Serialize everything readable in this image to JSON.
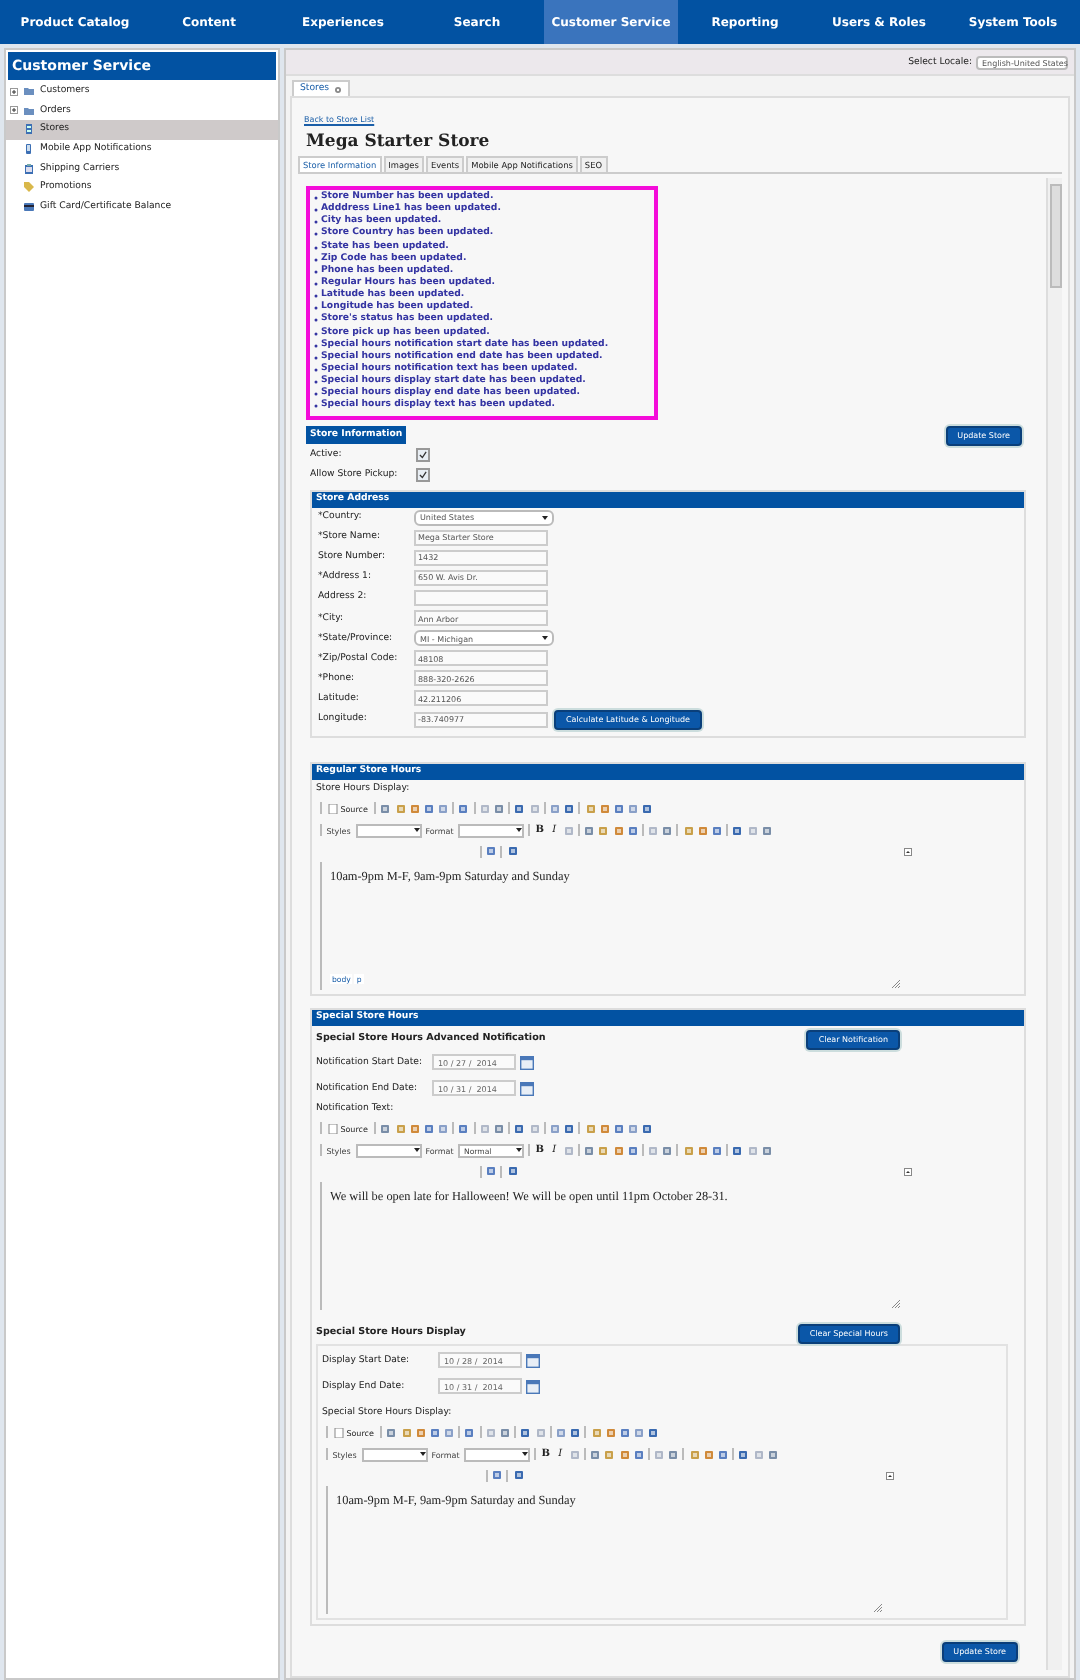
{
  "nav": [
    {
      "label": "Product Catalog",
      "selected": false
    },
    {
      "label": "Content",
      "selected": false
    },
    {
      "label": "Experiences",
      "selected": false
    },
    {
      "label": "Search",
      "selected": false
    },
    {
      "label": "Customer Service",
      "selected": true
    },
    {
      "label": "Reporting",
      "selected": false
    },
    {
      "label": "Users & Roles",
      "selected": false
    },
    {
      "label": "System Tools",
      "selected": false
    }
  ],
  "sidebar": {
    "title": "Customer Service",
    "items": [
      {
        "label": "Customers",
        "kind": "folder",
        "selected": false
      },
      {
        "label": "Orders",
        "kind": "folder",
        "selected": false
      },
      {
        "label": "Stores",
        "kind": "store",
        "selected": true
      },
      {
        "label": "Mobile App Notifications",
        "kind": "phone",
        "selected": false
      },
      {
        "label": "Shipping Carriers",
        "kind": "carrier",
        "selected": false
      },
      {
        "label": "Promotions",
        "kind": "tag",
        "selected": false
      },
      {
        "label": "Gift Card/Certificate Balance",
        "kind": "card",
        "selected": false
      }
    ]
  },
  "locale": {
    "label": "Select Locale:",
    "value": "English-United States"
  },
  "page_tab": {
    "label": "Stores"
  },
  "back_link": "Back to Store List",
  "title": "Mega Starter Store",
  "tabs": [
    {
      "label": "Store Information",
      "selected": true
    },
    {
      "label": "Images",
      "selected": false
    },
    {
      "label": "Events",
      "selected": false
    },
    {
      "label": "Mobile App Notifications",
      "selected": false
    },
    {
      "label": "SEO",
      "selected": false
    }
  ],
  "messages": [
    "Store Number has been updated.",
    "Adddress Line1 has been updated.",
    "City has been updated.",
    "Store Country has been updated.",
    "State has been updated.",
    "Zip Code has been updated.",
    "Phone has been updated.",
    "Regular Hours has been updated.",
    "Latitude has been updated.",
    "Longitude has been updated.",
    "Store's status has been updated.",
    "Store pick up has been updated.",
    "Special hours notification start date has been updated.",
    "Special hours notification end date has been updated.",
    "Special hours notification text has been updated.",
    "Special hours display start date has been updated.",
    "Special hours display end date has been updated.",
    "Special hours display text has been updated."
  ],
  "store_info": {
    "header": "Store Information",
    "button": "Update Store",
    "checks": [
      {
        "label": "Active:",
        "checked": true
      },
      {
        "label": "Allow Store Pickup:",
        "checked": true
      }
    ]
  },
  "address": {
    "header": "Store Address",
    "calc_button": "Calculate Latitude & Longitude",
    "fields": [
      {
        "label": "*Country:",
        "value": "United States",
        "kind": "select"
      },
      {
        "label": "*Store Name:",
        "value": "Mega Starter Store",
        "kind": "text"
      },
      {
        "label": "Store Number:",
        "value": "1432",
        "kind": "text"
      },
      {
        "label": "*Address 1:",
        "value": "650 W. Avis Dr.",
        "kind": "text"
      },
      {
        "label": "Address 2:",
        "kind": "text"
      },
      {
        "label": "*City:",
        "value": "Ann Arbor",
        "kind": "text"
      },
      {
        "label": "*State/Province:",
        "value": "MI - Michigan",
        "kind": "select"
      },
      {
        "label": "*Zip/Postal Code:",
        "value": "48108",
        "kind": "text"
      },
      {
        "label": "*Phone:",
        "value": "888-320-2626",
        "kind": "text"
      },
      {
        "label": "Latitude:",
        "value": "42.211206",
        "kind": "text"
      },
      {
        "label": "Longitude:",
        "value": "-83.740977",
        "kind": "text"
      }
    ]
  },
  "regular_hours": {
    "header": "Regular Store Hours",
    "editor_label": "Store Hours Display:",
    "editor": {
      "source": "Source",
      "styles": "Styles",
      "format": "Format",
      "bold": "B",
      "italic": "I",
      "content": "10am-9pm M-F, 9am-9pm Saturday and Sunday",
      "path": [
        "body",
        "p"
      ]
    }
  },
  "special_hours": {
    "header": "Special Store Hours",
    "notification": {
      "title": "Special Store Hours Advanced Notification",
      "button": "Clear Notification",
      "dates": [
        {
          "label": "Notification Start Date:",
          "value": "10 / 27 /  2014"
        },
        {
          "label": "Notification End Date:",
          "value": "10 / 31 /  2014"
        }
      ],
      "editor_label": "Notification Text:",
      "editor": {
        "source": "Source",
        "styles": "Styles",
        "format": "Format",
        "format_value": "Normal",
        "bold": "B",
        "italic": "I",
        "content": "We will be open late for Halloween!  We will be open until 11pm October 28-31."
      }
    },
    "display": {
      "title": "Special Store Hours Display",
      "button": "Clear Special Hours",
      "dates": [
        {
          "label": "Display Start Date:",
          "value": "10 / 28 /  2014"
        },
        {
          "label": "Display End Date:",
          "value": "10 / 31 /  2014"
        }
      ],
      "editor_label": "Special Store Hours Display:",
      "editor": {
        "source": "Source",
        "styles": "Styles",
        "format": "Format",
        "bold": "B",
        "italic": "I",
        "content": "10am-9pm M-F, 9am-9pm Saturday and Sunday"
      }
    }
  },
  "footer_button": "Update Store"
}
